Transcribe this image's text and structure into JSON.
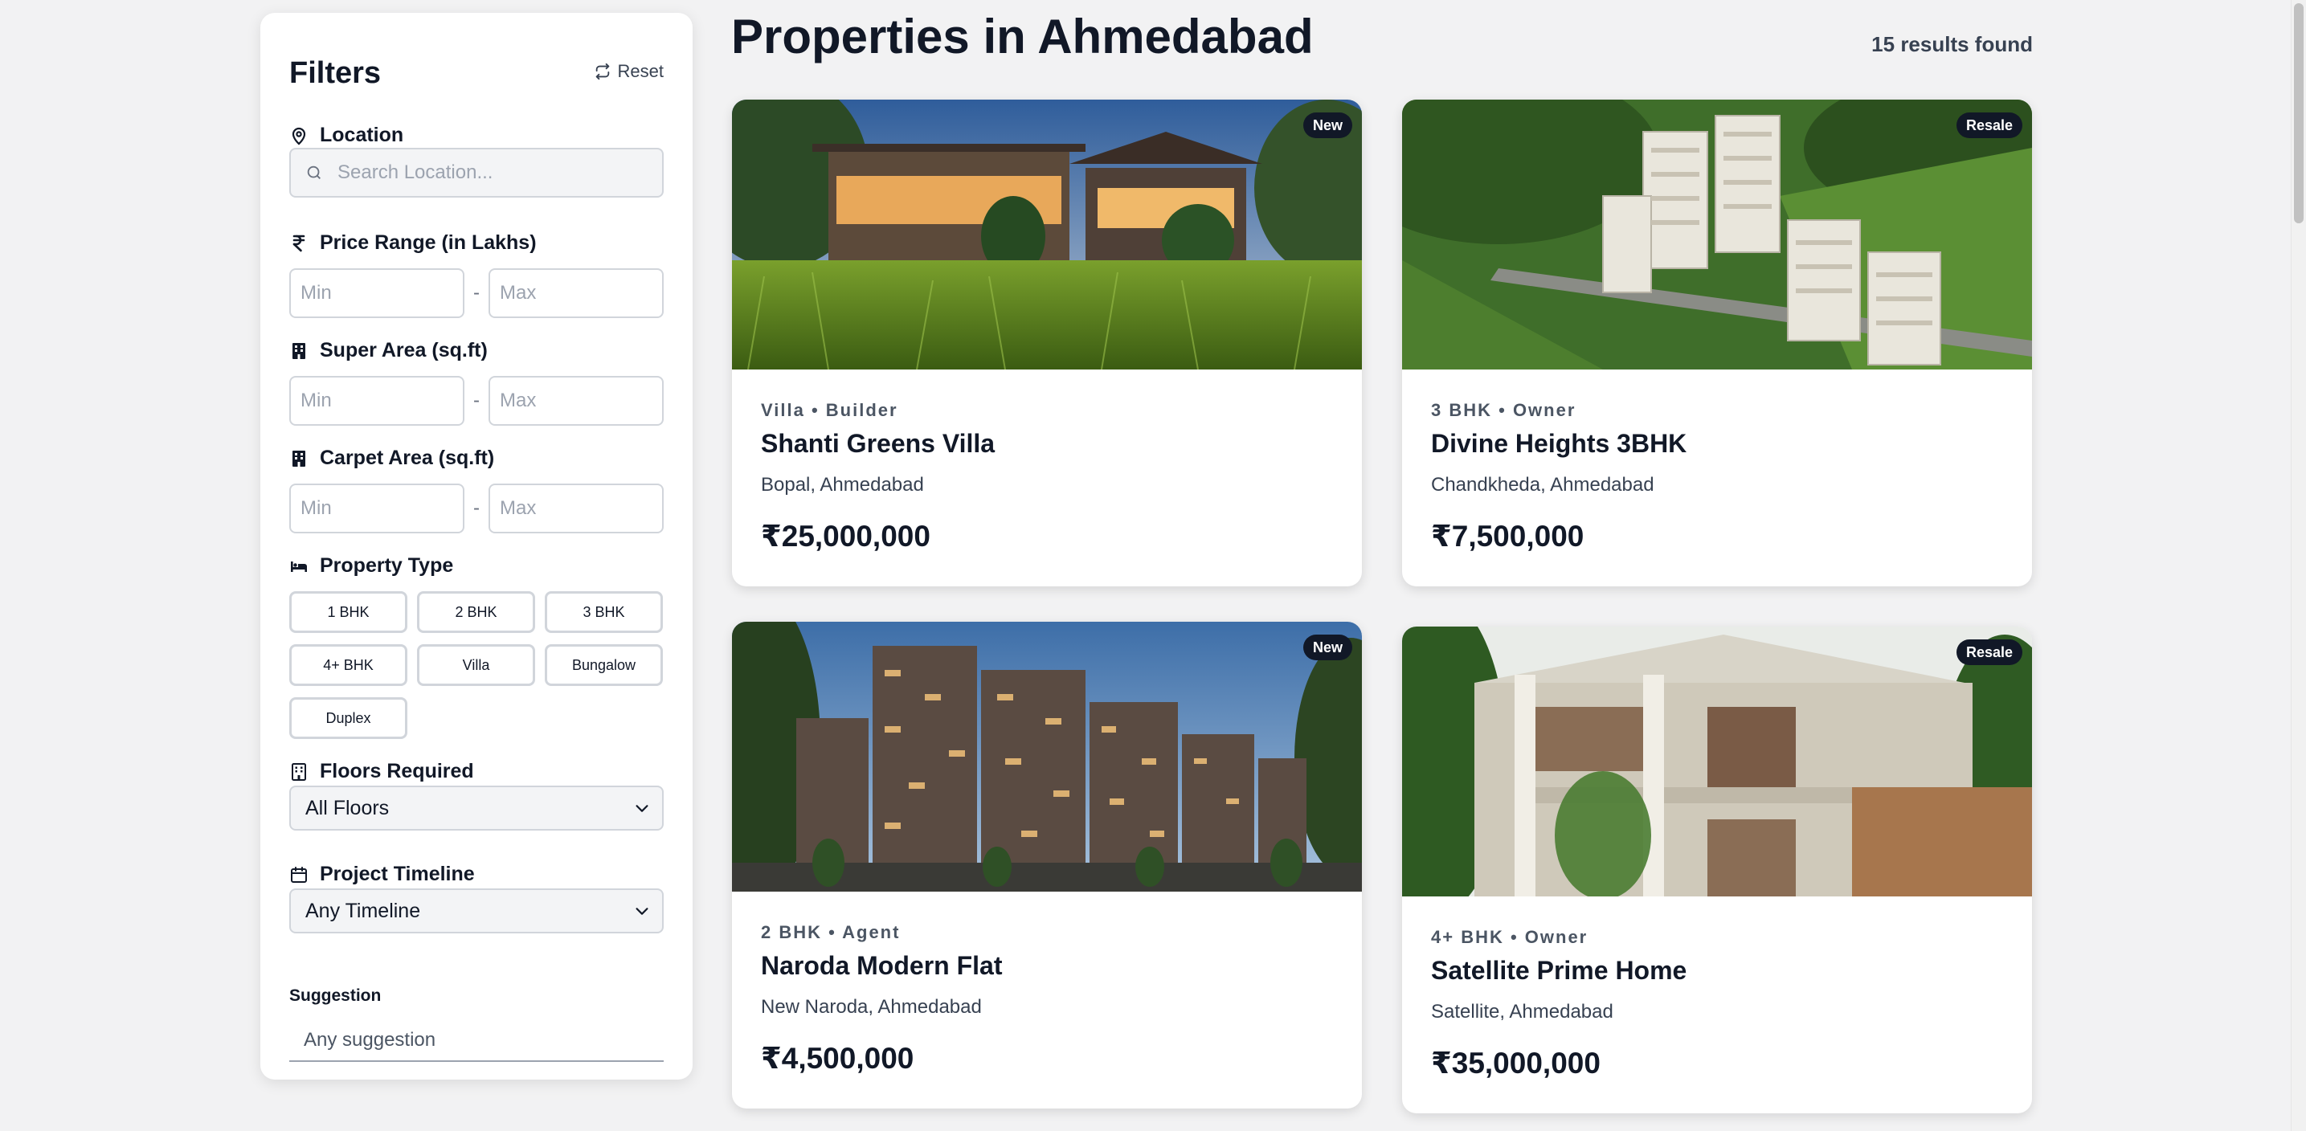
{
  "sidebar": {
    "title": "Filters",
    "reset_label": "Reset",
    "location": {
      "label": "Location",
      "placeholder": "Search Location..."
    },
    "price": {
      "label": "Price Range (in Lakhs)",
      "min_placeholder": "Min",
      "max_placeholder": "Max",
      "dash": "-"
    },
    "super_area": {
      "label": "Super Area (sq.ft)",
      "min_placeholder": "Min",
      "max_placeholder": "Max",
      "dash": "-"
    },
    "carpet_area": {
      "label": "Carpet Area (sq.ft)",
      "min_placeholder": "Min",
      "max_placeholder": "Max",
      "dash": "-"
    },
    "property_type": {
      "label": "Property Type",
      "options": [
        "1 BHK",
        "2 BHK",
        "3 BHK",
        "4+ BHK",
        "Villa",
        "Bungalow",
        "Duplex"
      ]
    },
    "floors": {
      "label": "Floors Required",
      "selected": "All Floors"
    },
    "timeline": {
      "label": "Project Timeline",
      "selected": "Any Timeline"
    },
    "suggestion": {
      "label": "Suggestion",
      "placeholder": "Any suggestion"
    }
  },
  "main": {
    "title": "Properties in Ahmedabad",
    "results": "15 results found",
    "cards": [
      {
        "badge": "New",
        "meta": "Villa • Builder",
        "name": "Shanti Greens Villa",
        "location": "Bopal, Ahmedabad",
        "price": "₹25,000,000"
      },
      {
        "badge": "Resale",
        "meta": "3 BHK • Owner",
        "name": "Divine Heights 3BHK",
        "location": "Chandkheda, Ahmedabad",
        "price": "₹7,500,000"
      },
      {
        "badge": "New",
        "meta": "2 BHK • Agent",
        "name": "Naroda Modern Flat",
        "location": "New Naroda, Ahmedabad",
        "price": "₹4,500,000"
      },
      {
        "badge": "Resale",
        "meta": "4+ BHK • Owner",
        "name": "Satellite Prime Home",
        "location": "Satellite, Ahmedabad",
        "price": "₹35,000,000"
      }
    ]
  },
  "colors": {
    "text": "#111827",
    "muted": "#4b5563",
    "badge_bg": "#111827",
    "page_bg": "#f2f2f3"
  },
  "icons": [
    "refresh-icon",
    "map-pin-icon",
    "search-icon",
    "rupee-icon",
    "building-icon",
    "bed-icon",
    "floors-icon",
    "calendar-icon",
    "chevron-down-icon"
  ]
}
